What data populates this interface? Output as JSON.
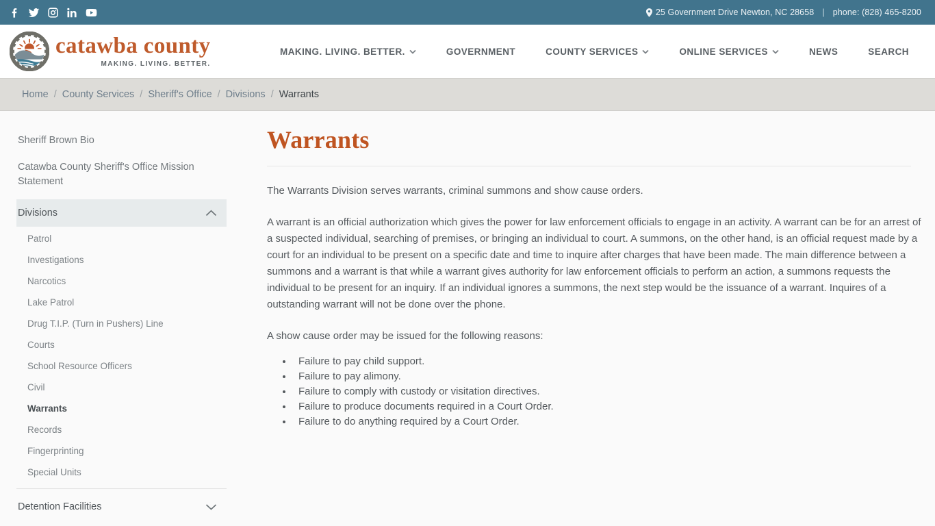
{
  "topbar": {
    "social": [
      {
        "name": "facebook-icon",
        "label": "Facebook"
      },
      {
        "name": "twitter-icon",
        "label": "Twitter"
      },
      {
        "name": "instagram-icon",
        "label": "Instagram"
      },
      {
        "name": "linkedin-icon",
        "label": "LinkedIn"
      },
      {
        "name": "youtube-icon",
        "label": "YouTube"
      }
    ],
    "address": "25 Government Drive Newton, NC 28658",
    "separator": "|",
    "phone": "phone: (828) 465-8200"
  },
  "header": {
    "brand_name": "catawba county",
    "brand_tagline": "MAKING. LIVING. BETTER.",
    "nav": [
      {
        "label": "MAKING. LIVING. BETTER.",
        "has_caret": true
      },
      {
        "label": "GOVERNMENT",
        "has_caret": false
      },
      {
        "label": "COUNTY SERVICES",
        "has_caret": true
      },
      {
        "label": "ONLINE SERVICES",
        "has_caret": true
      },
      {
        "label": "NEWS",
        "has_caret": false
      },
      {
        "label": "SEARCH",
        "has_caret": false
      }
    ]
  },
  "breadcrumb": {
    "separator": "/",
    "items": [
      {
        "label": "Home",
        "current": false
      },
      {
        "label": "County Services",
        "current": false
      },
      {
        "label": "Sheriff's Office",
        "current": false
      },
      {
        "label": "Divisions",
        "current": false
      },
      {
        "label": "Warrants",
        "current": true
      }
    ]
  },
  "sidebar": {
    "links": [
      "Sheriff Brown Bio",
      "Catawba County Sheriff's Office Mission Statement"
    ],
    "divisions": {
      "title": "Divisions",
      "expanded": true,
      "items": [
        {
          "label": "Patrol",
          "active": false
        },
        {
          "label": "Investigations",
          "active": false
        },
        {
          "label": "Narcotics",
          "active": false
        },
        {
          "label": "Lake Patrol",
          "active": false
        },
        {
          "label": "Drug T.I.P. (Turn in Pushers) Line",
          "active": false
        },
        {
          "label": "Courts",
          "active": false
        },
        {
          "label": "School Resource Officers",
          "active": false
        },
        {
          "label": "Civil",
          "active": false
        },
        {
          "label": "Warrants",
          "active": true
        },
        {
          "label": "Records",
          "active": false
        },
        {
          "label": "Fingerprinting",
          "active": false
        },
        {
          "label": "Special Units",
          "active": false
        }
      ]
    },
    "detention": {
      "title": "Detention Facilities",
      "expanded": false
    }
  },
  "main": {
    "title": "Warrants",
    "paragraph_1": "The Warrants Division serves warrants, criminal summons and show cause orders.",
    "paragraph_2": "A warrant is an official authorization which gives the power for law enforcement officials to engage in an activity. A warrant can be for an arrest of a suspected individual, searching of premises, or bringing an individual to court. A summons, on the other hand, is an official request made by a court for an individual to be present on a specific date and time to inquire after charges that have been made. The main difference between a summons and a warrant is that while a warrant gives authority for law enforcement officials to perform an action, a summons requests the individual to be present for an inquiry. If an individual ignores a summons, the next step would be the issuance of a warrant. Inquires of a outstanding warrant will not be done over the phone.",
    "paragraph_3": "A show cause order may be issued for the following reasons:",
    "reasons": [
      "Failure to pay child support.",
      "Failure to pay alimony.",
      "Failure to comply with custody or visitation directives.",
      "Failure to produce documents required in a Court Order.",
      "Failure to do anything required by a Court Order."
    ]
  },
  "colors": {
    "topbar_bg": "#41748d",
    "breadcrumb_bg": "#dddcd8",
    "brand_orange": "#bf5b2c",
    "title_orange": "#bf5421",
    "sidebar_section_bg": "#e7ebec"
  }
}
